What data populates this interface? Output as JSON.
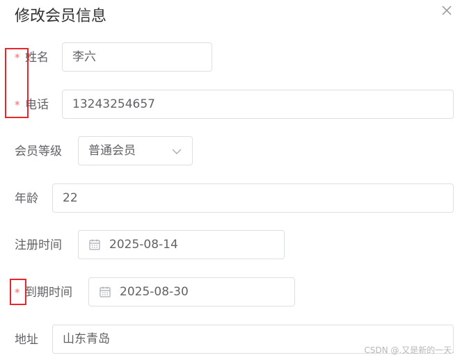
{
  "dialog": {
    "title": "修改会员信息",
    "close_icon": "close-icon"
  },
  "form": {
    "required_mark": "*",
    "name": {
      "label": "姓名",
      "value": "李六",
      "required": true
    },
    "phone": {
      "label": "电话",
      "value": "13243254657",
      "required": true
    },
    "level": {
      "label": "会员等级",
      "value": "普通会员",
      "icon": "chevron-down-icon"
    },
    "age": {
      "label": "年龄",
      "value": "22"
    },
    "register_time": {
      "label": "注册时间",
      "value": "2025-08-14",
      "icon": "calendar-icon"
    },
    "expire_time": {
      "label": "到期时间",
      "value": "2025-08-30",
      "required": true,
      "icon": "calendar-icon"
    },
    "address": {
      "label": "地址",
      "value": "山东青岛"
    }
  },
  "watermark": "CSDN @.又是新的一天.",
  "colors": {
    "required": "#f56c6c",
    "highlight_box": "#e8262b",
    "border": "#dcdfe6"
  }
}
